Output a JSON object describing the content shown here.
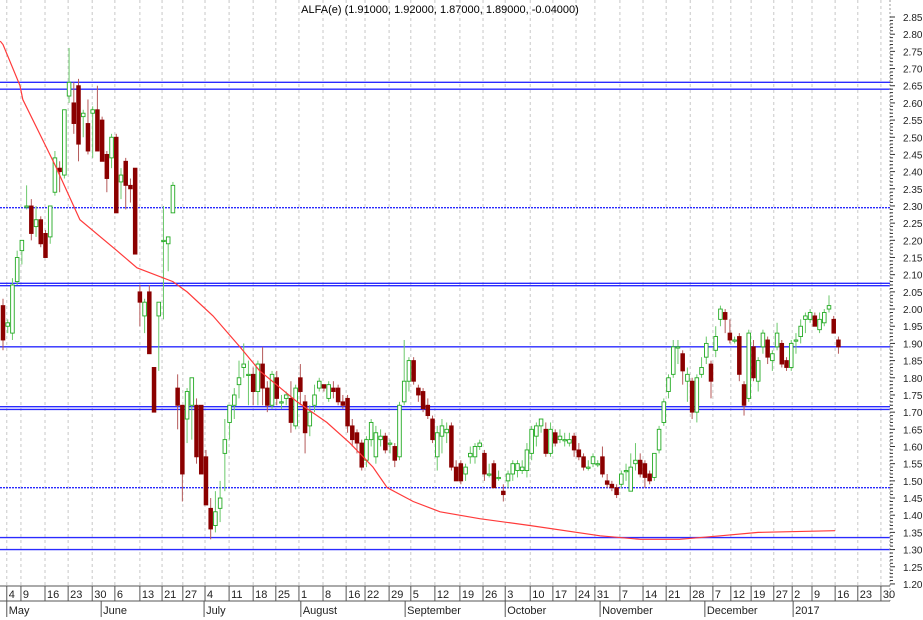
{
  "chart_data": {
    "type": "candlestick",
    "title": "ALFA(e) (1.91000, 1.92000, 1.87000, 1.89000, -0.04000)",
    "ylim": [
      1.2,
      2.85
    ],
    "y_ticks": [
      "2.85",
      "2.80",
      "2.75",
      "2.70",
      "2.65",
      "2.60",
      "2.55",
      "2.50",
      "2.45",
      "2.40",
      "2.35",
      "2.30",
      "2.25",
      "2.20",
      "2.15",
      "2.10",
      "2.05",
      "2.00",
      "1.95",
      "1.90",
      "1.85",
      "1.80",
      "1.75",
      "1.70",
      "1.65",
      "1.60",
      "1.55",
      "1.50",
      "1.45",
      "1.40",
      "1.35",
      "1.30",
      "1.25",
      "1.20"
    ],
    "x_range_trading_days": [
      -0.6,
      187.5
    ],
    "date_ticks": [
      {
        "t": 0.8,
        "label": "4"
      },
      {
        "t": 3.8,
        "label": "9"
      },
      {
        "t": 8.9,
        "label": "16"
      },
      {
        "t": 13.8,
        "label": "23"
      },
      {
        "t": 18.9,
        "label": "30"
      },
      {
        "t": 23.7,
        "label": "6"
      },
      {
        "t": 29.0,
        "label": "13"
      },
      {
        "t": 33.7,
        "label": "21"
      },
      {
        "t": 38.1,
        "label": "27"
      },
      {
        "t": 42.8,
        "label": "4"
      },
      {
        "t": 47.9,
        "label": "11"
      },
      {
        "t": 53.0,
        "label": "18"
      },
      {
        "t": 57.8,
        "label": "25"
      },
      {
        "t": 62.7,
        "label": "1"
      },
      {
        "t": 67.8,
        "label": "8"
      },
      {
        "t": 72.7,
        "label": "16"
      },
      {
        "t": 76.7,
        "label": "22"
      },
      {
        "t": 81.8,
        "label": "29"
      },
      {
        "t": 86.4,
        "label": "5"
      },
      {
        "t": 91.5,
        "label": "12"
      },
      {
        "t": 96.8,
        "label": "19"
      },
      {
        "t": 101.7,
        "label": "26"
      },
      {
        "t": 106.4,
        "label": "3"
      },
      {
        "t": 111.7,
        "label": "10"
      },
      {
        "t": 116.5,
        "label": "17"
      },
      {
        "t": 121.4,
        "label": "24"
      },
      {
        "t": 125.4,
        "label": "31"
      },
      {
        "t": 130.7,
        "label": "7"
      },
      {
        "t": 135.6,
        "label": "14"
      },
      {
        "t": 140.5,
        "label": "21"
      },
      {
        "t": 145.6,
        "label": "28"
      },
      {
        "t": 150.4,
        "label": "7"
      },
      {
        "t": 154.2,
        "label": "12"
      },
      {
        "t": 158.5,
        "label": "19"
      },
      {
        "t": 163.3,
        "label": "27"
      },
      {
        "t": 167.2,
        "label": "2"
      },
      {
        "t": 171.4,
        "label": "9"
      },
      {
        "t": 176.3,
        "label": "16"
      },
      {
        "t": 181.1,
        "label": "23"
      },
      {
        "t": 186.0,
        "label": "30"
      }
    ],
    "month_ticks": [
      {
        "t": 0.8,
        "label": "May"
      },
      {
        "t": 20.8,
        "label": "June"
      },
      {
        "t": 42.6,
        "label": "July"
      },
      {
        "t": 63.1,
        "label": "August"
      },
      {
        "t": 85.2,
        "label": "September"
      },
      {
        "t": 106.4,
        "label": "October"
      },
      {
        "t": 126.5,
        "label": "November"
      },
      {
        "t": 148.7,
        "label": "December"
      },
      {
        "t": 167.4,
        "label": "2017"
      }
    ],
    "ohlc_fields": [
      "open",
      "high",
      "low",
      "close"
    ],
    "candles": [
      [
        2.01,
        2.03,
        1.88,
        1.91
      ],
      [
        1.95,
        1.97,
        1.93,
        1.96
      ],
      [
        1.93,
        2.09,
        1.91,
        2.07
      ],
      [
        2.08,
        2.17,
        2.07,
        2.15
      ],
      [
        2.17,
        2.2,
        2.13,
        2.2
      ],
      [
        2.3,
        2.36,
        2.29,
        2.3
      ],
      [
        2.3,
        2.32,
        2.2,
        2.22
      ],
      [
        2.24,
        2.3,
        2.21,
        2.26
      ],
      [
        2.26,
        2.27,
        2.18,
        2.19
      ],
      [
        2.22,
        2.23,
        2.15,
        2.15
      ],
      [
        2.21,
        2.3,
        2.19,
        2.3
      ],
      [
        2.34,
        2.46,
        2.33,
        2.44
      ],
      [
        2.41,
        2.43,
        2.34,
        2.4
      ],
      [
        2.39,
        2.58,
        2.38,
        2.58
      ],
      [
        2.62,
        2.76,
        2.6,
        2.66
      ],
      [
        2.6,
        2.66,
        2.51,
        2.54
      ],
      [
        2.65,
        2.67,
        2.43,
        2.48
      ],
      [
        2.56,
        2.58,
        2.5,
        2.57
      ],
      [
        2.54,
        2.61,
        2.45,
        2.46
      ],
      [
        2.57,
        2.59,
        2.44,
        2.58
      ],
      [
        2.58,
        2.65,
        2.46,
        2.46
      ],
      [
        2.55,
        2.56,
        2.43,
        2.43
      ],
      [
        2.45,
        2.46,
        2.34,
        2.38
      ],
      [
        2.44,
        2.51,
        2.41,
        2.5
      ],
      [
        2.5,
        2.51,
        2.28,
        2.28
      ],
      [
        2.37,
        2.41,
        2.32,
        2.39
      ],
      [
        2.43,
        2.44,
        2.29,
        2.36
      ],
      [
        2.36,
        2.38,
        2.31,
        2.35
      ],
      [
        2.41,
        2.41,
        2.16,
        2.16
      ],
      [
        2.05,
        2.07,
        1.95,
        2.02
      ],
      [
        1.98,
        2.03,
        1.93,
        2.02
      ],
      [
        2.05,
        2.07,
        1.87,
        1.87
      ],
      [
        1.83,
        1.83,
        1.7,
        1.7
      ],
      [
        1.98,
        2.02,
        1.82,
        2.02
      ],
      [
        2.2,
        2.3,
        1.97,
        2.2
      ],
      [
        2.19,
        2.21,
        2.11,
        2.21
      ],
      [
        2.28,
        2.37,
        2.28,
        2.36
      ],
      [
        1.77,
        1.81,
        1.65,
        1.72
      ],
      [
        1.72,
        1.72,
        1.44,
        1.52
      ],
      [
        1.68,
        1.77,
        1.61,
        1.76
      ],
      [
        1.72,
        1.8,
        1.62,
        1.8
      ],
      [
        1.72,
        1.74,
        1.55,
        1.57
      ],
      [
        1.72,
        1.72,
        1.52,
        1.52
      ],
      [
        1.57,
        1.59,
        1.43,
        1.43
      ],
      [
        1.42,
        1.45,
        1.33,
        1.36
      ],
      [
        1.37,
        1.47,
        1.35,
        1.41
      ],
      [
        1.42,
        1.5,
        1.38,
        1.45
      ],
      [
        1.58,
        1.68,
        1.47,
        1.62
      ],
      [
        1.67,
        1.72,
        1.62,
        1.72
      ],
      [
        1.72,
        1.77,
        1.68,
        1.75
      ],
      [
        1.78,
        1.85,
        1.74,
        1.8
      ],
      [
        1.83,
        1.9,
        1.8,
        1.84
      ],
      [
        1.81,
        1.85,
        1.72,
        1.81
      ],
      [
        1.81,
        1.83,
        1.72,
        1.76
      ],
      [
        1.76,
        1.85,
        1.72,
        1.84
      ],
      [
        1.84,
        1.89,
        1.72,
        1.77
      ],
      [
        1.77,
        1.79,
        1.7,
        1.72
      ],
      [
        1.72,
        1.82,
        1.71,
        1.81
      ],
      [
        1.8,
        1.82,
        1.72,
        1.74
      ],
      [
        1.73,
        1.75,
        1.71,
        1.73
      ],
      [
        1.74,
        1.76,
        1.72,
        1.75
      ],
      [
        1.74,
        1.79,
        1.64,
        1.67
      ],
      [
        1.66,
        1.78,
        1.65,
        1.77
      ],
      [
        1.8,
        1.84,
        1.72,
        1.76
      ],
      [
        1.73,
        1.75,
        1.58,
        1.64
      ],
      [
        1.66,
        1.72,
        1.63,
        1.7
      ],
      [
        1.72,
        1.78,
        1.7,
        1.75
      ],
      [
        1.77,
        1.8,
        1.76,
        1.79
      ],
      [
        1.78,
        1.78,
        1.76,
        1.77
      ],
      [
        1.74,
        1.79,
        1.73,
        1.78
      ],
      [
        1.77,
        1.79,
        1.74,
        1.76
      ],
      [
        1.77,
        1.78,
        1.72,
        1.73
      ],
      [
        1.73,
        1.75,
        1.71,
        1.72
      ],
      [
        1.74,
        1.75,
        1.64,
        1.66
      ],
      [
        1.66,
        1.68,
        1.6,
        1.62
      ],
      [
        1.64,
        1.65,
        1.58,
        1.61
      ],
      [
        1.61,
        1.62,
        1.53,
        1.54
      ],
      [
        1.56,
        1.63,
        1.54,
        1.62
      ],
      [
        1.62,
        1.68,
        1.6,
        1.67
      ],
      [
        1.57,
        1.66,
        1.55,
        1.64
      ],
      [
        1.62,
        1.65,
        1.6,
        1.63
      ],
      [
        1.63,
        1.64,
        1.58,
        1.59
      ],
      [
        1.61,
        1.62,
        1.58,
        1.61
      ],
      [
        1.6,
        1.61,
        1.54,
        1.56
      ],
      [
        1.57,
        1.73,
        1.56,
        1.72
      ],
      [
        1.73,
        1.91,
        1.72,
        1.79
      ],
      [
        1.79,
        1.86,
        1.76,
        1.85
      ],
      [
        1.85,
        1.86,
        1.78,
        1.79
      ],
      [
        1.77,
        1.78,
        1.73,
        1.75
      ],
      [
        1.76,
        1.77,
        1.7,
        1.71
      ],
      [
        1.72,
        1.74,
        1.68,
        1.69
      ],
      [
        1.68,
        1.69,
        1.61,
        1.62
      ],
      [
        1.57,
        1.66,
        1.53,
        1.64
      ],
      [
        1.63,
        1.68,
        1.58,
        1.66
      ],
      [
        1.64,
        1.67,
        1.61,
        1.65
      ],
      [
        1.66,
        1.67,
        1.53,
        1.54
      ],
      [
        1.54,
        1.56,
        1.5,
        1.5
      ],
      [
        1.55,
        1.56,
        1.49,
        1.5
      ],
      [
        1.52,
        1.55,
        1.5,
        1.54
      ],
      [
        1.57,
        1.6,
        1.55,
        1.58
      ],
      [
        1.57,
        1.61,
        1.55,
        1.6
      ],
      [
        1.6,
        1.62,
        1.59,
        1.61
      ],
      [
        1.58,
        1.59,
        1.5,
        1.52
      ],
      [
        1.52,
        1.55,
        1.51,
        1.52
      ],
      [
        1.55,
        1.56,
        1.48,
        1.48
      ],
      [
        1.51,
        1.53,
        1.5,
        1.51
      ],
      [
        1.47,
        1.49,
        1.44,
        1.46
      ],
      [
        1.5,
        1.53,
        1.48,
        1.52
      ],
      [
        1.52,
        1.56,
        1.5,
        1.55
      ],
      [
        1.53,
        1.56,
        1.51,
        1.55
      ],
      [
        1.53,
        1.56,
        1.52,
        1.54
      ],
      [
        1.53,
        1.61,
        1.51,
        1.59
      ],
      [
        1.58,
        1.66,
        1.56,
        1.65
      ],
      [
        1.63,
        1.67,
        1.6,
        1.66
      ],
      [
        1.66,
        1.68,
        1.64,
        1.68
      ],
      [
        1.65,
        1.67,
        1.57,
        1.58
      ],
      [
        1.58,
        1.67,
        1.57,
        1.65
      ],
      [
        1.64,
        1.65,
        1.6,
        1.61
      ],
      [
        1.62,
        1.65,
        1.61,
        1.63
      ],
      [
        1.62,
        1.64,
        1.6,
        1.62
      ],
      [
        1.61,
        1.64,
        1.6,
        1.62
      ],
      [
        1.63,
        1.64,
        1.57,
        1.59
      ],
      [
        1.59,
        1.61,
        1.56,
        1.57
      ],
      [
        1.57,
        1.58,
        1.53,
        1.54
      ],
      [
        1.54,
        1.56,
        1.53,
        1.54
      ],
      [
        1.55,
        1.58,
        1.54,
        1.57
      ],
      [
        1.55,
        1.56,
        1.54,
        1.55
      ],
      [
        1.57,
        1.6,
        1.51,
        1.52
      ],
      [
        1.5,
        1.52,
        1.48,
        1.49
      ],
      [
        1.49,
        1.5,
        1.47,
        1.48
      ],
      [
        1.48,
        1.49,
        1.45,
        1.46
      ],
      [
        1.49,
        1.53,
        1.48,
        1.52
      ],
      [
        1.53,
        1.55,
        1.5,
        1.53
      ],
      [
        1.47,
        1.58,
        1.47,
        1.54
      ],
      [
        1.55,
        1.61,
        1.53,
        1.56
      ],
      [
        1.56,
        1.58,
        1.51,
        1.52
      ],
      [
        1.55,
        1.56,
        1.48,
        1.51
      ],
      [
        1.52,
        1.53,
        1.49,
        1.5
      ],
      [
        1.51,
        1.58,
        1.5,
        1.58
      ],
      [
        1.59,
        1.66,
        1.58,
        1.65
      ],
      [
        1.67,
        1.74,
        1.66,
        1.73
      ],
      [
        1.76,
        1.81,
        1.74,
        1.8
      ],
      [
        1.81,
        1.91,
        1.8,
        1.89
      ],
      [
        1.89,
        1.91,
        1.84,
        1.89
      ],
      [
        1.87,
        1.88,
        1.78,
        1.82
      ],
      [
        1.79,
        1.83,
        1.73,
        1.81
      ],
      [
        1.79,
        1.8,
        1.68,
        1.7
      ],
      [
        1.7,
        1.81,
        1.67,
        1.8
      ],
      [
        1.81,
        1.86,
        1.8,
        1.83
      ],
      [
        1.86,
        1.92,
        1.84,
        1.9
      ],
      [
        1.84,
        1.85,
        1.74,
        1.79
      ],
      [
        1.88,
        1.95,
        1.86,
        1.92
      ],
      [
        1.97,
        2.01,
        1.95,
        2.0
      ],
      [
        1.99,
        2.0,
        1.93,
        1.97
      ],
      [
        1.93,
        1.97,
        1.9,
        1.91
      ],
      [
        1.91,
        1.92,
        1.9,
        1.91
      ],
      [
        1.92,
        1.93,
        1.79,
        1.81
      ],
      [
        1.78,
        1.79,
        1.69,
        1.72
      ],
      [
        1.74,
        1.94,
        1.73,
        1.93
      ],
      [
        1.89,
        1.91,
        1.79,
        1.8
      ],
      [
        1.79,
        1.86,
        1.76,
        1.85
      ],
      [
        1.89,
        1.94,
        1.87,
        1.93
      ],
      [
        1.91,
        1.92,
        1.84,
        1.86
      ],
      [
        1.85,
        1.88,
        1.82,
        1.87
      ],
      [
        1.89,
        1.96,
        1.88,
        1.93
      ],
      [
        1.9,
        1.91,
        1.83,
        1.84
      ],
      [
        1.85,
        1.86,
        1.82,
        1.83
      ],
      [
        1.83,
        1.91,
        1.82,
        1.9
      ],
      [
        1.91,
        1.93,
        1.87,
        1.91
      ],
      [
        1.92,
        1.97,
        1.9,
        1.95
      ],
      [
        1.97,
        1.99,
        1.93,
        1.98
      ],
      [
        1.97,
        2.0,
        1.96,
        1.99
      ],
      [
        1.98,
        1.99,
        1.95,
        1.95
      ],
      [
        1.94,
        1.99,
        1.93,
        1.97
      ],
      [
        1.96,
        2.0,
        1.95,
        1.99
      ],
      [
        2.0,
        2.04,
        1.99,
        2.01
      ],
      [
        1.97,
        1.98,
        1.93,
        1.93
      ],
      [
        1.91,
        1.92,
        1.87,
        1.89
      ]
    ],
    "moving_average": [
      [
        -0.6,
        2.78
      ],
      [
        0,
        2.77
      ],
      [
        3.6,
        2.65
      ],
      [
        4.2,
        2.61
      ],
      [
        11,
        2.42
      ],
      [
        16.3,
        2.26
      ],
      [
        24.1,
        2.17
      ],
      [
        28.4,
        2.12
      ],
      [
        36,
        2.08
      ],
      [
        39,
        2.05
      ],
      [
        44.5,
        1.98
      ],
      [
        50.2,
        1.89
      ],
      [
        54.4,
        1.82
      ],
      [
        62.3,
        1.73
      ],
      [
        68.6,
        1.67
      ],
      [
        73.5,
        1.61
      ],
      [
        78.4,
        1.54
      ],
      [
        81.4,
        1.48
      ],
      [
        86.9,
        1.44
      ],
      [
        92.6,
        1.41
      ],
      [
        101,
        1.39
      ],
      [
        111.6,
        1.37
      ],
      [
        126.5,
        1.34
      ],
      [
        135,
        1.33
      ],
      [
        143.4,
        1.33
      ],
      [
        152,
        1.34
      ],
      [
        160,
        1.35
      ],
      [
        176.3,
        1.355
      ]
    ],
    "horizontal_levels": [
      {
        "value": 2.66,
        "style": "solid"
      },
      {
        "value": 2.64,
        "style": "solid"
      },
      {
        "value": 2.295,
        "style": "dotted"
      },
      {
        "value": 2.075,
        "style": "solid"
      },
      {
        "value": 2.068,
        "style": "solid"
      },
      {
        "value": 1.89,
        "style": "solid"
      },
      {
        "value": 1.716,
        "style": "solid"
      },
      {
        "value": 1.708,
        "style": "solid"
      },
      {
        "value": 1.48,
        "style": "dotted"
      },
      {
        "value": 1.335,
        "style": "solid"
      },
      {
        "value": 1.3,
        "style": "solid"
      }
    ],
    "colors": {
      "up": "#22aa22",
      "up_fill": "#ffffff",
      "down": "#8b0000",
      "level": "#2a2aff",
      "ma": "#ff3a3a",
      "grid": "#c8c8c8"
    },
    "grid": true
  }
}
